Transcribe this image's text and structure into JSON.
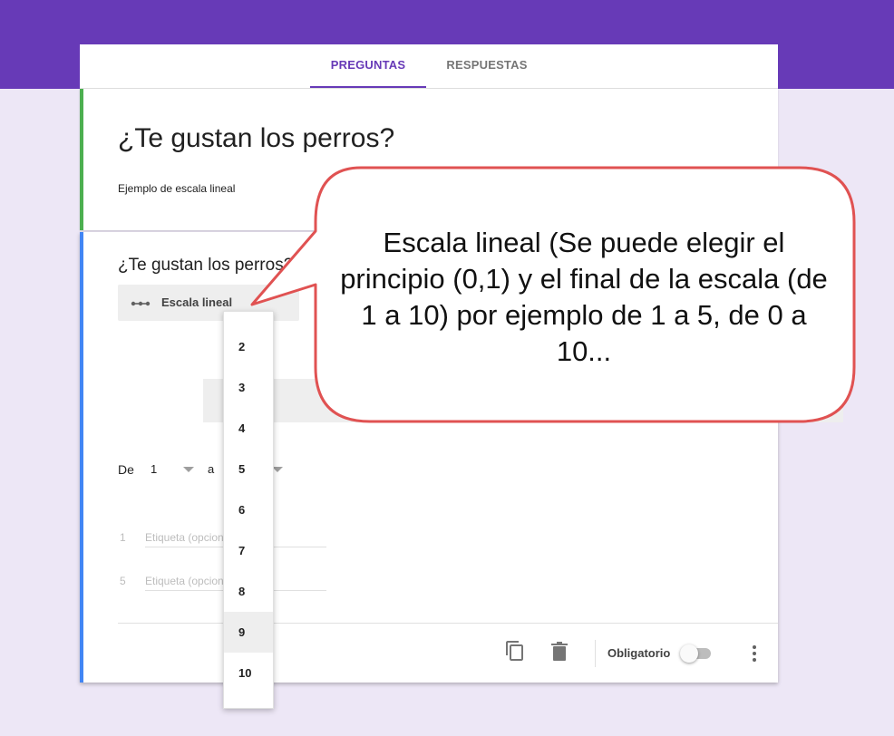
{
  "tabs": [
    {
      "label": "PREGUNTAS",
      "active": true
    },
    {
      "label": "RESPUESTAS",
      "active": false
    }
  ],
  "form": {
    "title": "¿Te gustan los perros?",
    "description": "Ejemplo de escala lineal"
  },
  "question": {
    "title": "¿Te gustan los perros?",
    "type_label": "Escala lineal",
    "range": {
      "from_label": "De",
      "from_value": "1",
      "to_label": "a"
    },
    "labels": [
      {
        "number": "1",
        "placeholder": "Etiqueta (opcional)"
      },
      {
        "number": "5",
        "placeholder": "Etiqueta (opcional)"
      }
    ],
    "required_label": "Obligatorio",
    "required": false
  },
  "dropdown": {
    "options": [
      "2",
      "3",
      "4",
      "5",
      "6",
      "7",
      "8",
      "9",
      "10"
    ],
    "highlighted": "9"
  },
  "callout": {
    "text": "Escala lineal (Se puede elegir el principio (0,1) y el final de la escala (de 1 a 10) por ejemplo de 1 a 5, de 0 a 10..."
  },
  "colors": {
    "brand": "#673ab7",
    "background": "#ede7f6",
    "header_accent": "#4caf50",
    "question_accent": "#4285f4",
    "callout_border": "#e05252"
  },
  "icons": {
    "type": "linear-scale-icon",
    "copy": "copy-icon",
    "delete": "trash-icon",
    "more": "more-vert-icon"
  }
}
